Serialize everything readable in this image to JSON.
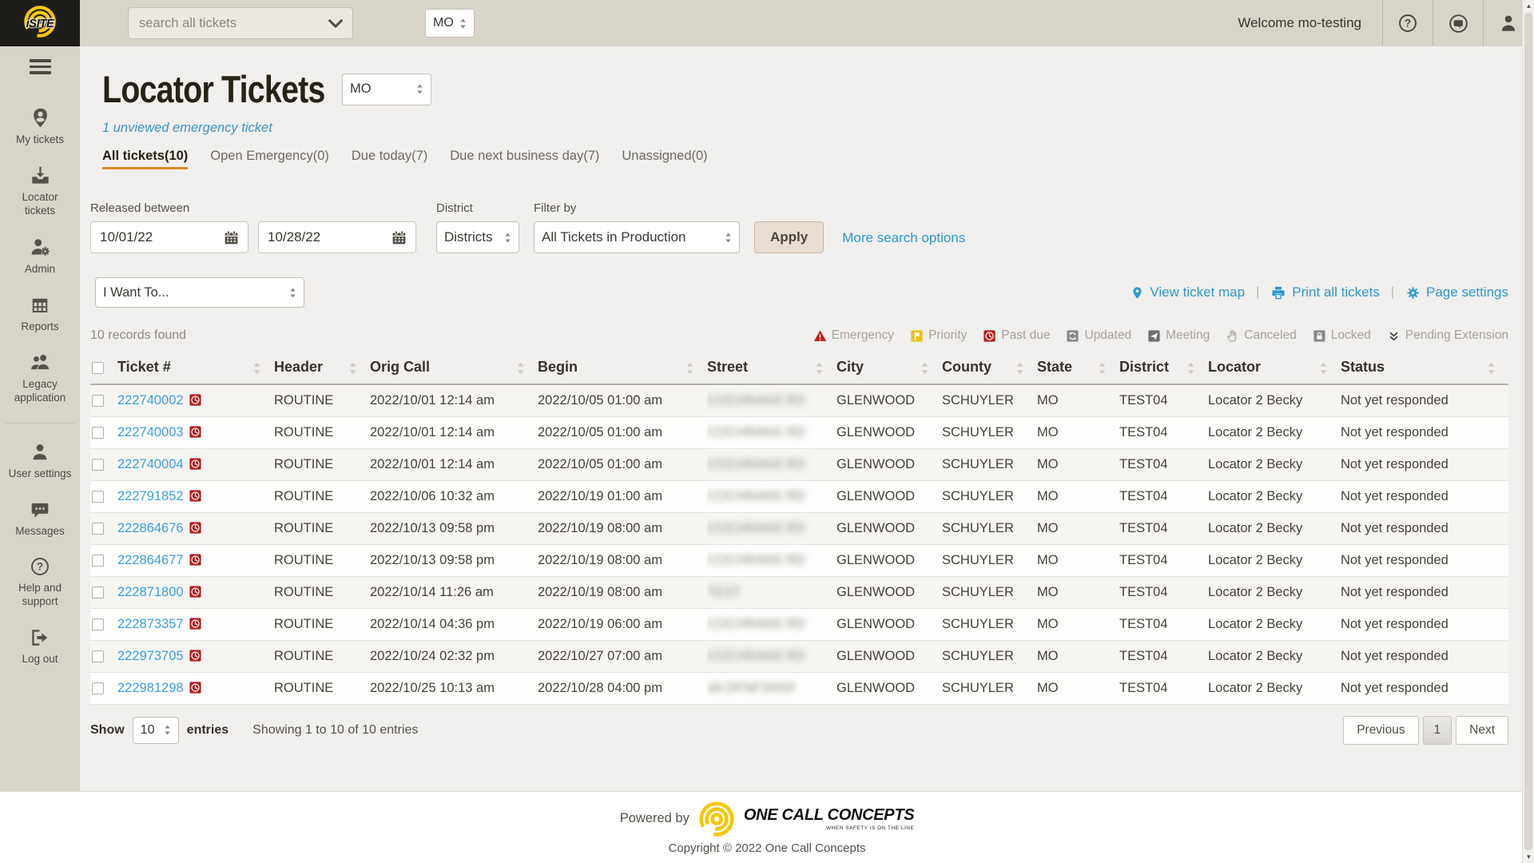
{
  "topbar": {
    "logo": "iSITE",
    "search_placeholder": "search all tickets",
    "region_value": "MO",
    "welcome": "Welcome mo-testing",
    "icons": [
      "help-icon",
      "chat-bubbles-icon",
      "user-icon"
    ]
  },
  "sidebar": {
    "items": [
      {
        "id": "my-tickets",
        "label": "My tickets",
        "icon": "pin-person-icon"
      },
      {
        "id": "locator-tickets",
        "label": "Locator tickets",
        "icon": "inbox-icon"
      },
      {
        "id": "admin",
        "label": "Admin",
        "icon": "person-gear-icon"
      },
      {
        "id": "reports",
        "label": "Reports",
        "icon": "grid-icon"
      },
      {
        "id": "legacy-application",
        "label": "Legacy application",
        "icon": "people-icon"
      },
      {
        "id": "user-settings",
        "label": "User settings",
        "icon": "person-icon",
        "divider_before": true
      },
      {
        "id": "messages",
        "label": "Messages",
        "icon": "chat-icon"
      },
      {
        "id": "help-support",
        "label": "Help and support",
        "icon": "help-icon"
      },
      {
        "id": "log-out",
        "label": "Log out",
        "icon": "logout-icon"
      }
    ]
  },
  "page": {
    "title": "Locator Tickets",
    "region_value": "MO",
    "emergency_notice": "1 unviewed emergency ticket",
    "tabs": [
      {
        "label": "All tickets(10)",
        "active": true
      },
      {
        "label": "Open Emergency(0)",
        "active": false
      },
      {
        "label": "Due today(7)",
        "active": false
      },
      {
        "label": "Due next business day(7)",
        "active": false
      },
      {
        "label": "Unassigned(0)",
        "active": false
      }
    ],
    "filters": {
      "released_label": "Released between",
      "date_from": "10/01/22",
      "date_to": "10/28/22",
      "district_label": "District",
      "district_value": "Districts",
      "filter_by_label": "Filter by",
      "filter_by_value": "All Tickets in Production",
      "apply_label": "Apply",
      "more_label": "More search options"
    },
    "actions": {
      "i_want_to": "I Want To...",
      "view_map": "View ticket map",
      "print_all": "Print all tickets",
      "page_settings": "Page settings"
    },
    "records_found": "10 records found",
    "legend": [
      {
        "label": "Emergency",
        "icon": "emergency-icon"
      },
      {
        "label": "Priority",
        "icon": "priority-icon"
      },
      {
        "label": "Past due",
        "icon": "pastdue-icon"
      },
      {
        "label": "Updated",
        "icon": "updated-icon"
      },
      {
        "label": "Meeting",
        "icon": "meeting-icon"
      },
      {
        "label": "Canceled",
        "icon": "canceled-icon"
      },
      {
        "label": "Locked",
        "icon": "locked-icon"
      },
      {
        "label": "Pending Extension",
        "icon": "pending-icon"
      }
    ],
    "table": {
      "columns": [
        "Ticket #",
        "Header",
        "Orig Call",
        "Begin",
        "Street",
        "City",
        "County",
        "State",
        "District",
        "Locator",
        "Status"
      ],
      "street_redacted": true,
      "rows": [
        {
          "ticket": "222740002",
          "flag": "pastdue-icon",
          "header": "ROUTINE",
          "orig_call": "2022/10/01 12:14 am",
          "begin": "2022/10/05 01:00 am",
          "street": "COCHRANS RD",
          "city": "GLENWOOD",
          "county": "SCHUYLER",
          "state": "MO",
          "district": "TEST04",
          "locator": "Locator 2 Becky",
          "status": "Not yet responded"
        },
        {
          "ticket": "222740003",
          "flag": "pastdue-icon",
          "header": "ROUTINE",
          "orig_call": "2022/10/01 12:14 am",
          "begin": "2022/10/05 01:00 am",
          "street": "COCHRANS RD",
          "city": "GLENWOOD",
          "county": "SCHUYLER",
          "state": "MO",
          "district": "TEST04",
          "locator": "Locator 2 Becky",
          "status": "Not yet responded"
        },
        {
          "ticket": "222740004",
          "flag": "pastdue-icon",
          "header": "ROUTINE",
          "orig_call": "2022/10/01 12:14 am",
          "begin": "2022/10/05 01:00 am",
          "street": "COCHRANS RD",
          "city": "GLENWOOD",
          "county": "SCHUYLER",
          "state": "MO",
          "district": "TEST04",
          "locator": "Locator 2 Becky",
          "status": "Not yet responded"
        },
        {
          "ticket": "222791852",
          "flag": "pastdue-icon",
          "header": "ROUTINE",
          "orig_call": "2022/10/06 10:32 am",
          "begin": "2022/10/19 01:00 am",
          "street": "COCHRANS RD",
          "city": "GLENWOOD",
          "county": "SCHUYLER",
          "state": "MO",
          "district": "TEST04",
          "locator": "Locator 2 Becky",
          "status": "Not yet responded"
        },
        {
          "ticket": "222864676",
          "flag": "pastdue-icon",
          "header": "ROUTINE",
          "orig_call": "2022/10/13 09:58 pm",
          "begin": "2022/10/19 08:00 am",
          "street": "COCHRANS RD",
          "city": "GLENWOOD",
          "county": "SCHUYLER",
          "state": "MO",
          "district": "TEST04",
          "locator": "Locator 2 Becky",
          "status": "Not yet responded"
        },
        {
          "ticket": "222864677",
          "flag": "pastdue-icon",
          "header": "ROUTINE",
          "orig_call": "2022/10/13 09:58 pm",
          "begin": "2022/10/19 08:00 am",
          "street": "COCHRANS RD",
          "city": "GLENWOOD",
          "county": "SCHUYLER",
          "state": "MO",
          "district": "TEST04",
          "locator": "Locator 2 Becky",
          "status": "Not yet responded"
        },
        {
          "ticket": "222871800",
          "flag": "pastdue-icon",
          "header": "ROUTINE",
          "orig_call": "2022/10/14 11:26 am",
          "begin": "2022/10/19 08:00 am",
          "street": "TEST",
          "city": "GLENWOOD",
          "county": "SCHUYLER",
          "state": "MO",
          "district": "TEST04",
          "locator": "Locator 2 Becky",
          "status": "Not yet responded"
        },
        {
          "ticket": "222873357",
          "flag": "pastdue-icon",
          "header": "ROUTINE",
          "orig_call": "2022/10/14 04:36 pm",
          "begin": "2022/10/19 06:00 am",
          "street": "COCHRANS RD",
          "city": "GLENWOOD",
          "county": "SCHUYLER",
          "state": "MO",
          "district": "TEST04",
          "locator": "Locator 2 Becky",
          "status": "Not yet responded"
        },
        {
          "ticket": "222973705",
          "flag": "pastdue-icon",
          "header": "ROUTINE",
          "orig_call": "2022/10/24 02:32 pm",
          "begin": "2022/10/27 07:00 am",
          "street": "COCHRANS RD",
          "city": "GLENWOOD",
          "county": "SCHUYLER",
          "state": "MO",
          "district": "TEST04",
          "locator": "Locator 2 Becky",
          "status": "Not yet responded"
        },
        {
          "ticket": "222981298",
          "flag": "pastdue-icon",
          "header": "ROUTINE",
          "orig_call": "2022/10/25 10:13 am",
          "begin": "2022/10/28 04:00 pm",
          "street": "3A DFNFSNSF",
          "city": "GLENWOOD",
          "county": "SCHUYLER",
          "state": "MO",
          "district": "TEST04",
          "locator": "Locator 2 Becky",
          "status": "Not yet responded"
        }
      ]
    },
    "table_footer": {
      "show_label": "Show",
      "page_size": "10",
      "entries_label": "entries",
      "showing": "Showing 1 to 10 of 10 entries",
      "prev": "Previous",
      "page": "1",
      "next": "Next"
    }
  },
  "footer": {
    "powered_by": "Powered by",
    "brand": "ONE CALL CONCEPTS",
    "tagline": "WHEN SAFETY IS ON THE LINE",
    "copyright": "Copyright © 2022 One Call Concepts"
  },
  "colors": {
    "topbar_bg": "#d8d4ca",
    "accent_blue": "#3aa0dc",
    "link_blue": "#2e97cf",
    "tab_underline": "#d98a2b",
    "pastdue_red": "#b51d1d",
    "emergency_red": "#c11b17",
    "priority_yellow": "#e9c216",
    "brand_yellow": "#f3c70c"
  }
}
